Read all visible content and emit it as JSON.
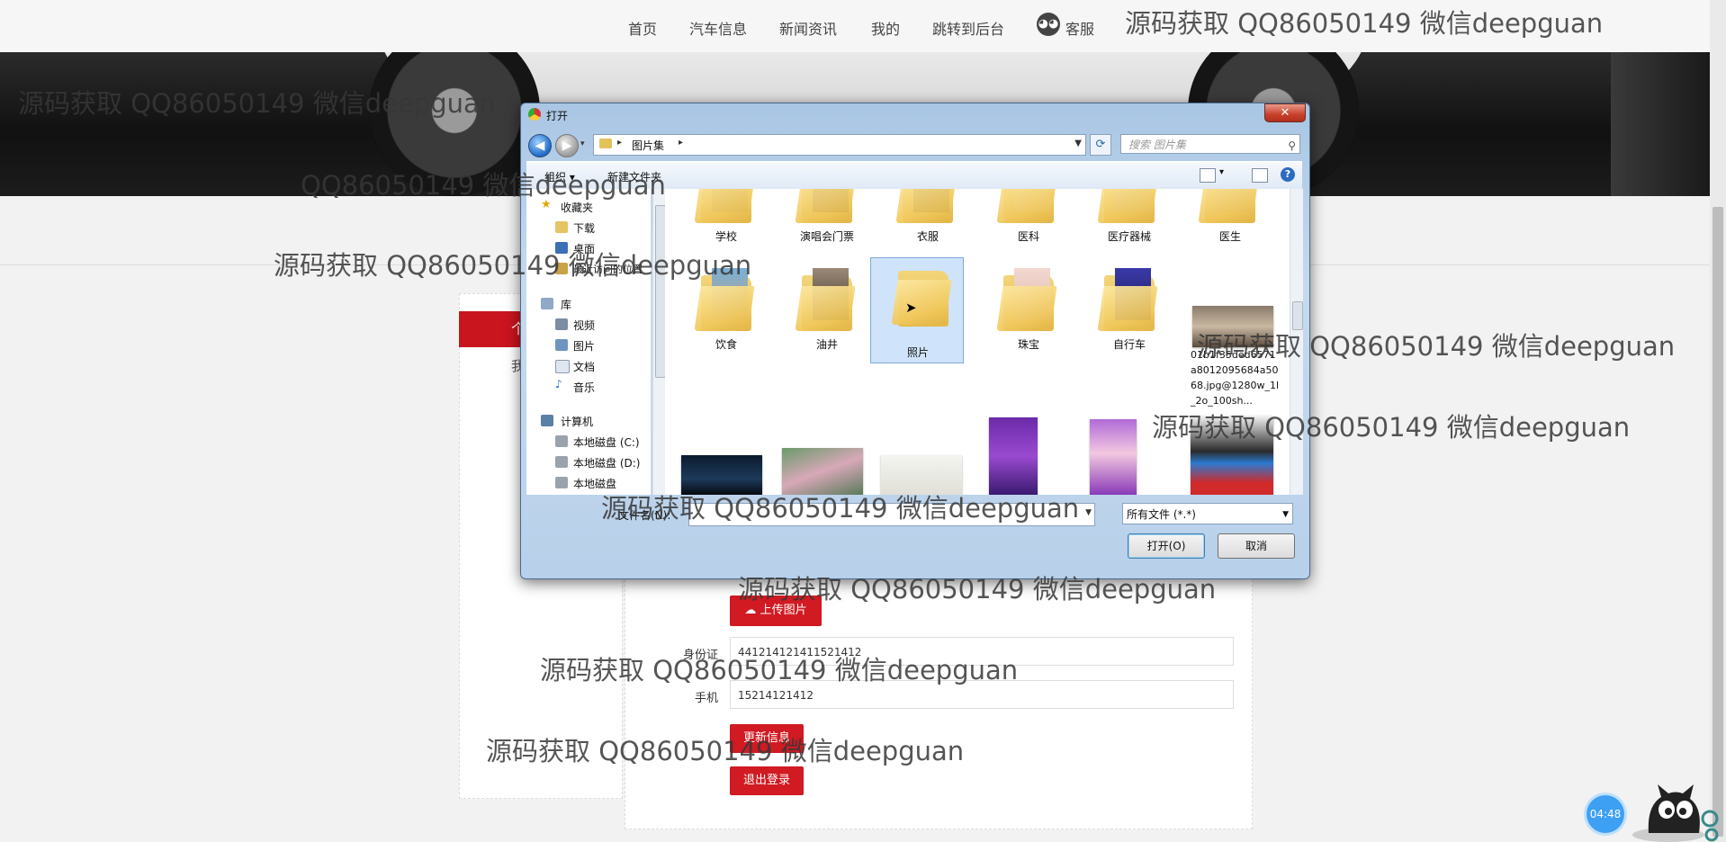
{
  "nav": {
    "items": [
      "首页",
      "汽车信息",
      "新闻资讯",
      "我的",
      "跳转到后台"
    ],
    "service_label": "客服"
  },
  "left_panel": {
    "tab_label": "个",
    "sub_label": "我"
  },
  "form": {
    "upload_label": "上传图片",
    "id_label": "身份证",
    "id_value": "441214121411521412",
    "phone_label": "手机",
    "phone_value": "15214121412",
    "update_label": "更新信息",
    "logout_label": "退出登录"
  },
  "timer": "04:48",
  "dialog": {
    "title": "打开",
    "close_glyph": "✕",
    "address": "图片集",
    "search_placeholder": "搜索 图片集",
    "toolbar": {
      "organize": "组织 ▾",
      "new_folder": "新建文件夹"
    },
    "nav_groups": [
      {
        "label": "收藏夹",
        "icon": "star-icon"
      },
      {
        "label": "下载",
        "icon": "download-folder-icon"
      },
      {
        "label": "桌面",
        "icon": "desktop-icon"
      },
      {
        "label": "最近访问的位置",
        "icon": "recent-places-icon"
      },
      {
        "label": "库",
        "icon": "library-icon"
      },
      {
        "label": "视频",
        "icon": "video-library-icon"
      },
      {
        "label": "图片",
        "icon": "pictures-library-icon"
      },
      {
        "label": "文档",
        "icon": "documents-library-icon"
      },
      {
        "label": "音乐",
        "icon": "music-library-icon"
      },
      {
        "label": "计算机",
        "icon": "computer-icon"
      },
      {
        "label": "本地磁盘 (C:)",
        "icon": "drive-icon"
      },
      {
        "label": "本地磁盘 (D:)",
        "icon": "drive-icon"
      },
      {
        "label": "本地磁盘",
        "icon": "drive-icon"
      }
    ],
    "folders_row1": [
      "学校",
      "演唱会门票",
      "衣服",
      "医科",
      "医疗器械",
      "医生"
    ],
    "folders_row2": [
      "饮食",
      "油井",
      "照片",
      "珠宝",
      "自行车"
    ],
    "image_file_name": "01b1f35ded6571a8012095684a5068.jpg@1280w_1l_2o_100sh...",
    "filename_label": "文件名(N):",
    "filename_value": "",
    "file_type": "所有文件 (*.*)",
    "open_button": "打开(O)",
    "cancel_button": "取消"
  },
  "watermarks": [
    "源码获取 QQ86050149 微信deepguan",
    "源码获取 QQ86050149 微信deepguan",
    "QQ86050149 微信deepguan",
    "源码获取 QQ86050149 微信deepguan",
    "源码获取 QQ86050149 微信deepguan",
    "源码获取 QQ86050149 微信deepguan",
    "源码获取 QQ86050149 微信deepguan",
    "源码获取 QQ86050149 微信deepguan",
    "源码获取 QQ86050149 微信deepguan",
    "源码获取 QQ86050149 微信deepguan"
  ],
  "colors": {
    "accent_red": "#c9151e",
    "selection": "#cfe3fb"
  }
}
